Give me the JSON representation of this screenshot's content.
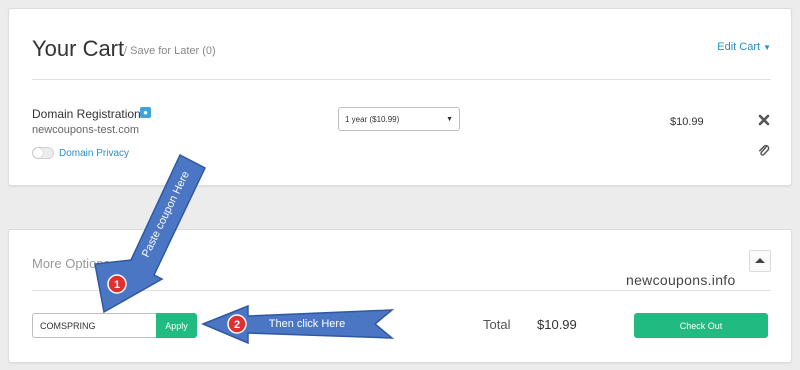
{
  "cart": {
    "title": "Your Cart",
    "save_for_later": "/ Save for Later (0)",
    "edit_cart": "Edit Cart",
    "item": {
      "name": "Domain Registration",
      "domain": "newcoupons-test.com",
      "privacy_label": "Domain Privacy",
      "privacy_enabled": false,
      "term": "1 year ($10.99)",
      "price": "$10.99",
      "icons": [
        "contact-icon",
        "remove-x-icon",
        "paperclip-icon"
      ]
    }
  },
  "options": {
    "title": "More Options",
    "coupon_value": "COMSPRING",
    "apply_label": "Apply",
    "total_label": "Total",
    "total_value": "$10.99",
    "checkout_label": "Check Out"
  },
  "watermark": "newcoupons.info",
  "annotations": {
    "arrow1_text": "Paste coupon Here",
    "arrow1_number": "1",
    "arrow2_text": "Then click Here",
    "arrow2_number": "2"
  },
  "colors": {
    "accent_green": "#21bb82",
    "link_blue": "#2a8fc9",
    "arrow_blue": "#4a76c4",
    "badge_red": "#e02f2f"
  }
}
